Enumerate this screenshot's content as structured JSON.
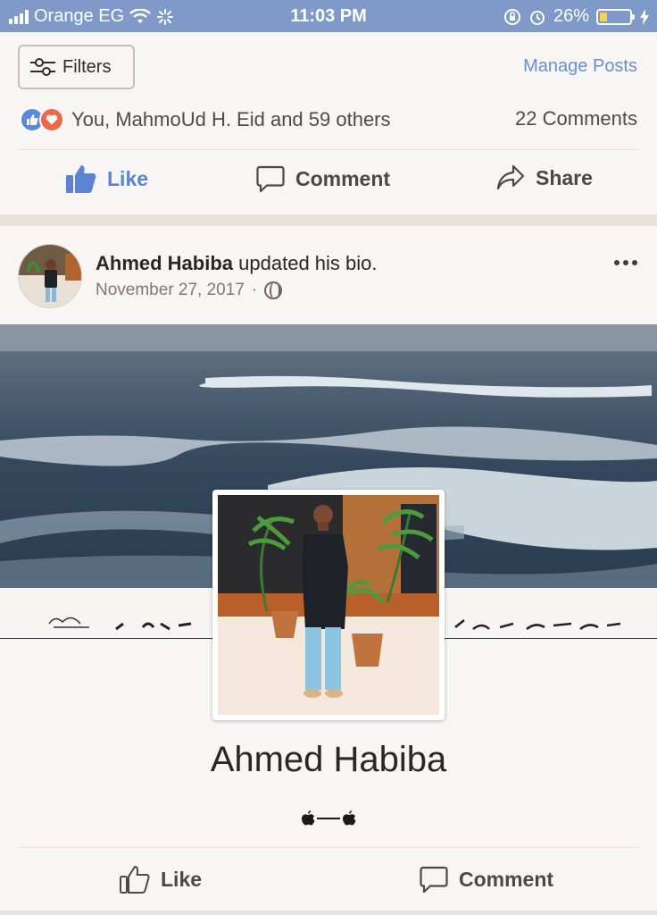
{
  "status_bar": {
    "carrier": "Orange EG",
    "time": "11:03 PM",
    "battery": "26%",
    "battery_level": 0.26
  },
  "top_card": {
    "filters_label": "Filters",
    "manage_posts_label": "Manage Posts",
    "reactions_text": "You, MahmoUd H. Eid and 59 others",
    "comments_count": "22 Comments",
    "actions": {
      "like": "Like",
      "comment": "Comment",
      "share": "Share"
    }
  },
  "post": {
    "author": "Ahmed Habiba",
    "activity": "updated his bio.",
    "date": "November 27, 2017",
    "bio_name": "Ahmed Habiba",
    "bio_text": "—",
    "actions": {
      "like": "Like",
      "comment": "Comment"
    }
  },
  "colors": {
    "status_bar": "#7f9ac9",
    "link_blue": "#6a8ed0",
    "like_blue": "#5c84d2",
    "love_red": "#f2674a"
  },
  "icons": [
    "signal-icon",
    "wifi-icon",
    "activity-icon",
    "lock-rotation-icon",
    "alarm-icon",
    "battery-icon",
    "charging-icon",
    "filter-sliders-icon",
    "like-reaction-icon",
    "love-reaction-icon",
    "thumbs-up-icon",
    "comment-bubble-icon",
    "share-arrow-icon",
    "globe-icon",
    "more-dots-icon"
  ]
}
